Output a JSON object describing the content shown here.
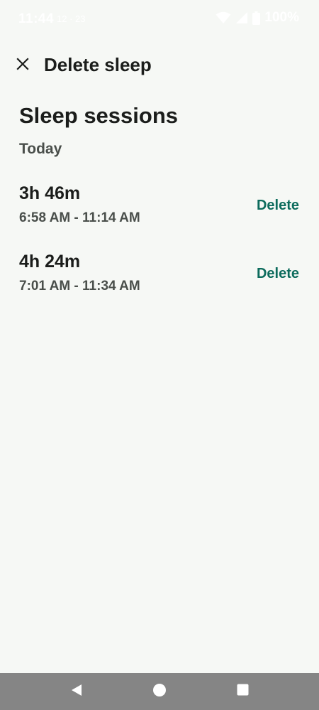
{
  "status_bar": {
    "time": "11:44",
    "extra": "12 · 23",
    "battery": "100%"
  },
  "app_bar": {
    "title": "Delete sleep"
  },
  "content": {
    "section_title": "Sleep sessions",
    "day_label": "Today",
    "sessions": [
      {
        "duration": "3h 46m",
        "range": "6:58 AM - 11:14 AM",
        "action": "Delete"
      },
      {
        "duration": "4h 24m",
        "range": "7:01 AM - 11:34 AM",
        "action": "Delete"
      }
    ]
  },
  "icons": {
    "close": "close-icon",
    "wifi": "wifi-icon",
    "signal": "signal-icon",
    "battery": "battery-icon",
    "back": "back-icon",
    "home": "home-icon",
    "recents": "recents-icon"
  },
  "colors": {
    "background": "#f6f8f5",
    "accent": "#0c6b5c",
    "nav_bar": "#858585"
  }
}
